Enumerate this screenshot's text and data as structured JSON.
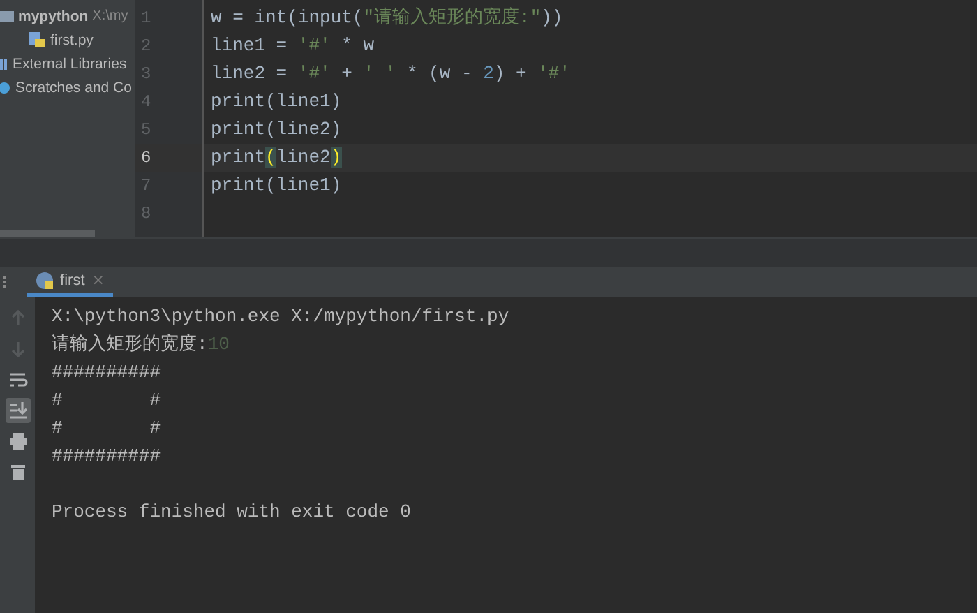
{
  "project_tree": [
    {
      "label": "mypython",
      "path": "X:\\my",
      "kind": "folder",
      "children": [
        {
          "label": "first.py",
          "kind": "python"
        }
      ]
    },
    {
      "label": "External Libraries",
      "kind": "libraries"
    },
    {
      "label": "Scratches and Co",
      "kind": "scratches"
    }
  ],
  "editor": {
    "lines": [
      {
        "number": "1",
        "selected": false,
        "segments": [
          {
            "kind": "code",
            "text": "w = int(input("
          },
          {
            "kind": "string",
            "text": "\"请输入矩形的宽度:\""
          },
          {
            "kind": "code",
            "text": "))"
          }
        ]
      },
      {
        "number": "2",
        "selected": false,
        "segments": [
          {
            "kind": "code",
            "text": "line1 = "
          },
          {
            "kind": "string",
            "text": "'#'"
          },
          {
            "kind": "code",
            "text": " * w"
          }
        ]
      },
      {
        "number": "3",
        "selected": false,
        "segments": [
          {
            "kind": "code",
            "text": "line2 = "
          },
          {
            "kind": "string",
            "text": "'#'"
          },
          {
            "kind": "code",
            "text": " + "
          },
          {
            "kind": "string",
            "text": "' '"
          },
          {
            "kind": "code",
            "text": " * (w - "
          },
          {
            "kind": "number",
            "text": "2"
          },
          {
            "kind": "code",
            "text": ") + "
          },
          {
            "kind": "string",
            "text": "'#'"
          }
        ]
      },
      {
        "number": "4",
        "selected": false,
        "segments": [
          {
            "kind": "code",
            "text": "print(line1)"
          }
        ]
      },
      {
        "number": "5",
        "selected": false,
        "segments": [
          {
            "kind": "code",
            "text": "print(line2)"
          }
        ]
      },
      {
        "number": "6",
        "selected": true,
        "segments": [
          {
            "kind": "code",
            "text": "print"
          },
          {
            "kind": "brace",
            "text": "("
          },
          {
            "kind": "code",
            "text": "line2"
          },
          {
            "kind": "brace",
            "text": ")"
          }
        ]
      },
      {
        "number": "7",
        "selected": false,
        "segments": [
          {
            "kind": "code",
            "text": "print(line1)"
          }
        ]
      },
      {
        "number": "8",
        "selected": false
      }
    ]
  },
  "run_tab": {
    "label": "first",
    "close": "×"
  },
  "run_tools": [
    {
      "kind": "up",
      "disabled": true,
      "selected": false
    },
    {
      "kind": "down",
      "disabled": true,
      "selected": false
    },
    {
      "kind": "wrap",
      "disabled": false,
      "selected": false
    },
    {
      "kind": "scroll-end",
      "disabled": false,
      "selected": true
    },
    {
      "kind": "print",
      "disabled": false,
      "selected": false
    },
    {
      "kind": "delete",
      "disabled": false,
      "selected": false
    }
  ],
  "console": [
    {
      "text": "X:\\python3\\python.exe X:/mypython/first.py"
    },
    {
      "text": "请输入矩形的宽度:",
      "input": "10"
    },
    {
      "text": "##########"
    },
    {
      "text": "#        #"
    },
    {
      "text": "#        #"
    },
    {
      "text": "##########"
    }
  ],
  "exit_message": "Process finished with exit code 0"
}
